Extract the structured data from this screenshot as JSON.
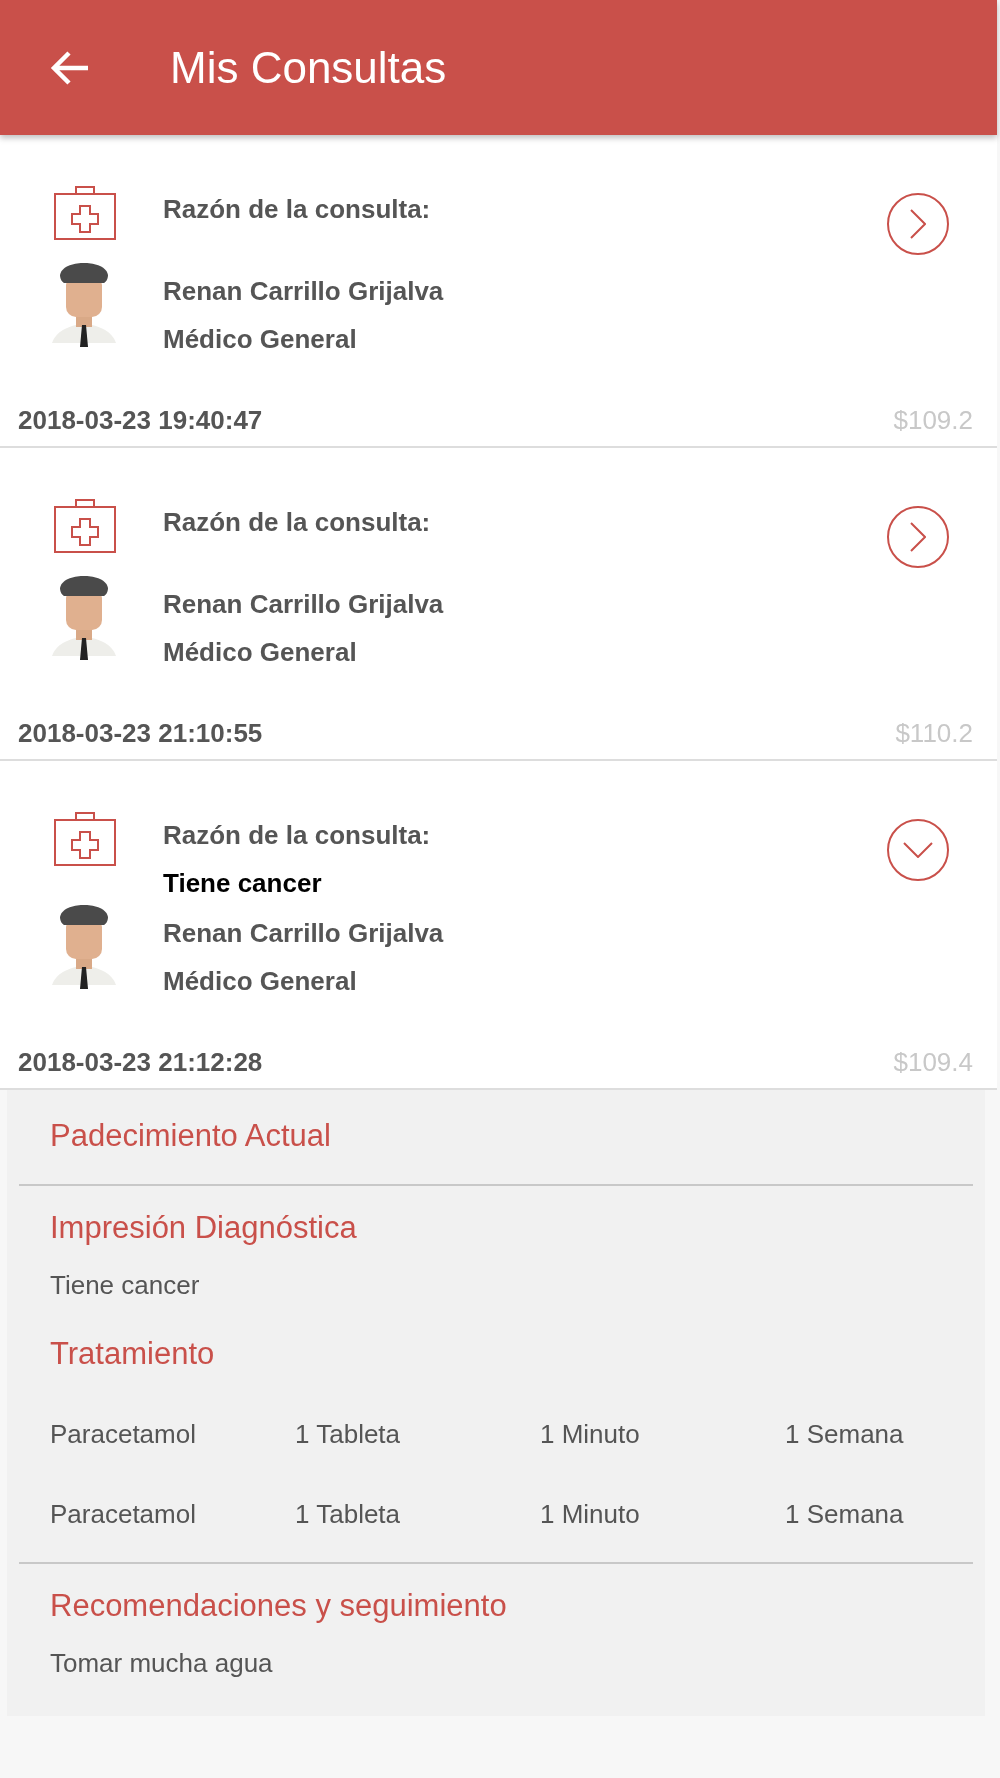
{
  "app_bar": {
    "title": "Mis Consultas"
  },
  "consultations": [
    {
      "reason_label": "Razón de la consulta:",
      "doctor": "Renan Carrillo Grijalva",
      "specialty": "Médico General",
      "datetime": "2018-03-23 19:40:47",
      "price": "$109.2",
      "expanded": false
    },
    {
      "reason_label": "Razón de la consulta:",
      "doctor": "Renan Carrillo Grijalva",
      "specialty": "Médico General",
      "datetime": "2018-03-23 21:10:55",
      "price": "$110.2",
      "expanded": false
    },
    {
      "reason_label": "Razón de la consulta:",
      "reason": "Tiene cancer",
      "doctor": "Renan Carrillo Grijalva",
      "specialty": "Médico General",
      "datetime": "2018-03-23 21:12:28",
      "price": "$109.4",
      "expanded": true,
      "details": [
        {
          "kind": "heading",
          "heading": "Padecimiento Actual",
          "divider": true
        },
        {
          "kind": "text",
          "heading": "Impresión Diagnóstica",
          "text": "Tiene cancer",
          "divider": false
        },
        {
          "kind": "table",
          "heading": "Tratamiento",
          "rows": [
            [
              "Paracetamol",
              "1 Tableta",
              "1 Minuto",
              "1 Semana"
            ],
            [
              "Paracetamol",
              "1 Tableta",
              "1 Minuto",
              "1 Semana"
            ]
          ],
          "divider": true
        },
        {
          "kind": "text",
          "heading": "Recomendaciones y seguimiento",
          "text": "Tomar mucha agua",
          "divider": false
        }
      ]
    }
  ]
}
